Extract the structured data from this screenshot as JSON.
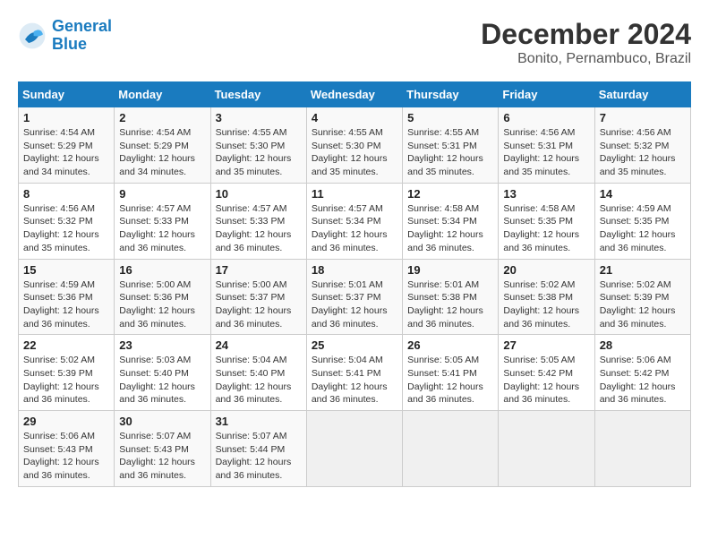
{
  "header": {
    "logo_general": "General",
    "logo_blue": "Blue",
    "title": "December 2024",
    "subtitle": "Bonito, Pernambuco, Brazil"
  },
  "calendar": {
    "days_of_week": [
      "Sunday",
      "Monday",
      "Tuesday",
      "Wednesday",
      "Thursday",
      "Friday",
      "Saturday"
    ],
    "weeks": [
      [
        null,
        {
          "day": "2",
          "sunrise": "4:54 AM",
          "sunset": "5:29 PM",
          "daylight": "12 hours and 34 minutes."
        },
        {
          "day": "3",
          "sunrise": "4:55 AM",
          "sunset": "5:30 PM",
          "daylight": "12 hours and 35 minutes."
        },
        {
          "day": "4",
          "sunrise": "4:55 AM",
          "sunset": "5:30 PM",
          "daylight": "12 hours and 35 minutes."
        },
        {
          "day": "5",
          "sunrise": "4:55 AM",
          "sunset": "5:31 PM",
          "daylight": "12 hours and 35 minutes."
        },
        {
          "day": "6",
          "sunrise": "4:56 AM",
          "sunset": "5:31 PM",
          "daylight": "12 hours and 35 minutes."
        },
        {
          "day": "7",
          "sunrise": "4:56 AM",
          "sunset": "5:32 PM",
          "daylight": "12 hours and 35 minutes."
        }
      ],
      [
        {
          "day": "1",
          "sunrise": "4:54 AM",
          "sunset": "5:29 PM",
          "daylight": "12 hours and 34 minutes."
        },
        {
          "day": "2",
          "sunrise": "4:54 AM",
          "sunset": "5:29 PM",
          "daylight": "12 hours and 34 minutes."
        },
        {
          "day": "3",
          "sunrise": "4:55 AM",
          "sunset": "5:30 PM",
          "daylight": "12 hours and 35 minutes."
        },
        {
          "day": "4",
          "sunrise": "4:55 AM",
          "sunset": "5:30 PM",
          "daylight": "12 hours and 35 minutes."
        },
        {
          "day": "5",
          "sunrise": "4:55 AM",
          "sunset": "5:31 PM",
          "daylight": "12 hours and 35 minutes."
        },
        {
          "day": "6",
          "sunrise": "4:56 AM",
          "sunset": "5:31 PM",
          "daylight": "12 hours and 35 minutes."
        },
        {
          "day": "7",
          "sunrise": "4:56 AM",
          "sunset": "5:32 PM",
          "daylight": "12 hours and 35 minutes."
        }
      ],
      [
        {
          "day": "8",
          "sunrise": "4:56 AM",
          "sunset": "5:32 PM",
          "daylight": "12 hours and 35 minutes."
        },
        {
          "day": "9",
          "sunrise": "4:57 AM",
          "sunset": "5:33 PM",
          "daylight": "12 hours and 36 minutes."
        },
        {
          "day": "10",
          "sunrise": "4:57 AM",
          "sunset": "5:33 PM",
          "daylight": "12 hours and 36 minutes."
        },
        {
          "day": "11",
          "sunrise": "4:57 AM",
          "sunset": "5:34 PM",
          "daylight": "12 hours and 36 minutes."
        },
        {
          "day": "12",
          "sunrise": "4:58 AM",
          "sunset": "5:34 PM",
          "daylight": "12 hours and 36 minutes."
        },
        {
          "day": "13",
          "sunrise": "4:58 AM",
          "sunset": "5:35 PM",
          "daylight": "12 hours and 36 minutes."
        },
        {
          "day": "14",
          "sunrise": "4:59 AM",
          "sunset": "5:35 PM",
          "daylight": "12 hours and 36 minutes."
        }
      ],
      [
        {
          "day": "15",
          "sunrise": "4:59 AM",
          "sunset": "5:36 PM",
          "daylight": "12 hours and 36 minutes."
        },
        {
          "day": "16",
          "sunrise": "5:00 AM",
          "sunset": "5:36 PM",
          "daylight": "12 hours and 36 minutes."
        },
        {
          "day": "17",
          "sunrise": "5:00 AM",
          "sunset": "5:37 PM",
          "daylight": "12 hours and 36 minutes."
        },
        {
          "day": "18",
          "sunrise": "5:01 AM",
          "sunset": "5:37 PM",
          "daylight": "12 hours and 36 minutes."
        },
        {
          "day": "19",
          "sunrise": "5:01 AM",
          "sunset": "5:38 PM",
          "daylight": "12 hours and 36 minutes."
        },
        {
          "day": "20",
          "sunrise": "5:02 AM",
          "sunset": "5:38 PM",
          "daylight": "12 hours and 36 minutes."
        },
        {
          "day": "21",
          "sunrise": "5:02 AM",
          "sunset": "5:39 PM",
          "daylight": "12 hours and 36 minutes."
        }
      ],
      [
        {
          "day": "22",
          "sunrise": "5:02 AM",
          "sunset": "5:39 PM",
          "daylight": "12 hours and 36 minutes."
        },
        {
          "day": "23",
          "sunrise": "5:03 AM",
          "sunset": "5:40 PM",
          "daylight": "12 hours and 36 minutes."
        },
        {
          "day": "24",
          "sunrise": "5:04 AM",
          "sunset": "5:40 PM",
          "daylight": "12 hours and 36 minutes."
        },
        {
          "day": "25",
          "sunrise": "5:04 AM",
          "sunset": "5:41 PM",
          "daylight": "12 hours and 36 minutes."
        },
        {
          "day": "26",
          "sunrise": "5:05 AM",
          "sunset": "5:41 PM",
          "daylight": "12 hours and 36 minutes."
        },
        {
          "day": "27",
          "sunrise": "5:05 AM",
          "sunset": "5:42 PM",
          "daylight": "12 hours and 36 minutes."
        },
        {
          "day": "28",
          "sunrise": "5:06 AM",
          "sunset": "5:42 PM",
          "daylight": "12 hours and 36 minutes."
        }
      ],
      [
        {
          "day": "29",
          "sunrise": "5:06 AM",
          "sunset": "5:43 PM",
          "daylight": "12 hours and 36 minutes."
        },
        {
          "day": "30",
          "sunrise": "5:07 AM",
          "sunset": "5:43 PM",
          "daylight": "12 hours and 36 minutes."
        },
        {
          "day": "31",
          "sunrise": "5:07 AM",
          "sunset": "5:44 PM",
          "daylight": "12 hours and 36 minutes."
        },
        null,
        null,
        null,
        null
      ]
    ],
    "week1": [
      {
        "day": "1",
        "sunrise": "4:54 AM",
        "sunset": "5:29 PM",
        "daylight": "12 hours and 34 minutes."
      },
      {
        "day": "2",
        "sunrise": "4:54 AM",
        "sunset": "5:29 PM",
        "daylight": "12 hours and 34 minutes."
      },
      {
        "day": "3",
        "sunrise": "4:55 AM",
        "sunset": "5:30 PM",
        "daylight": "12 hours and 35 minutes."
      },
      {
        "day": "4",
        "sunrise": "4:55 AM",
        "sunset": "5:30 PM",
        "daylight": "12 hours and 35 minutes."
      },
      {
        "day": "5",
        "sunrise": "4:55 AM",
        "sunset": "5:31 PM",
        "daylight": "12 hours and 35 minutes."
      },
      {
        "day": "6",
        "sunrise": "4:56 AM",
        "sunset": "5:31 PM",
        "daylight": "12 hours and 35 minutes."
      },
      {
        "day": "7",
        "sunrise": "4:56 AM",
        "sunset": "5:32 PM",
        "daylight": "12 hours and 35 minutes."
      }
    ]
  }
}
